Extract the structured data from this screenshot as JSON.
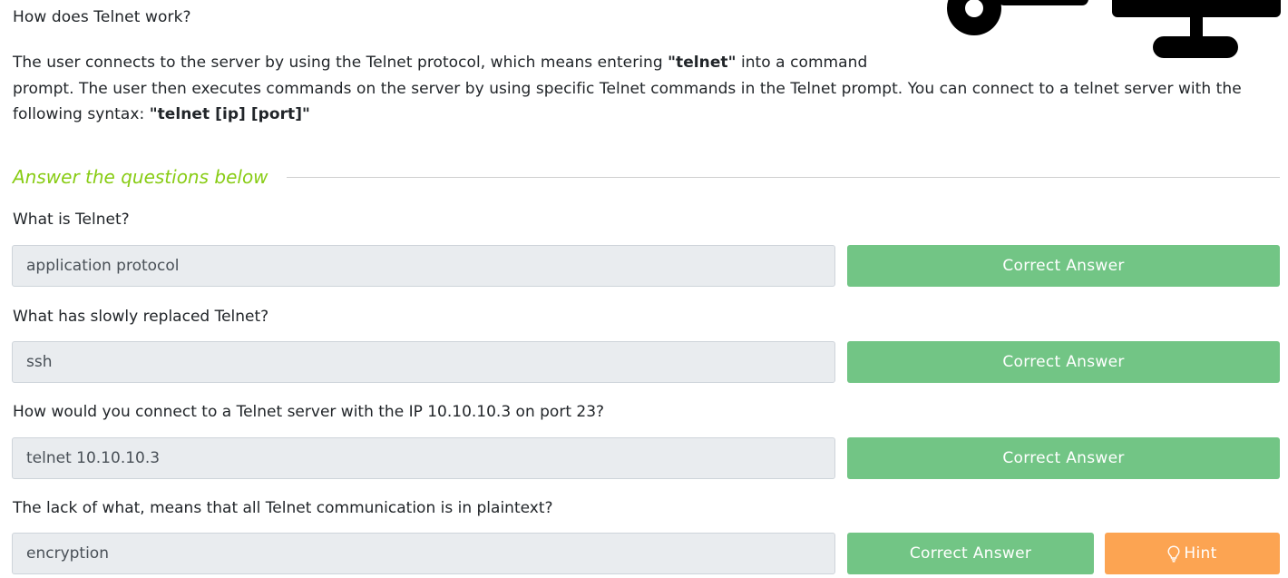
{
  "section": {
    "heading": "How does Telnet work?",
    "paragraph": {
      "line1_a": "The user connects to the server by using the Telnet protocol, which means entering ",
      "line1_b": "\"telnet\"",
      "line1_c": " into a command",
      "line2": "prompt. The user then executes commands on the server by using specific Telnet commands in the Telnet prompt. You can connect to a telnet server with the",
      "line3_a": "following syntax: ",
      "line3_b": "\"telnet [ip] [port]\""
    }
  },
  "answers": {
    "title": "Answer the questions below",
    "questions": [
      {
        "question": "What is Telnet?",
        "answer": "application protocol",
        "button": "Correct Answer"
      },
      {
        "question": "What has slowly replaced Telnet?",
        "answer": "ssh",
        "button": "Correct Answer"
      },
      {
        "question": "How would you connect to a Telnet server with the IP 10.10.10.3 on port 23?",
        "answer": "telnet 10.10.10.3",
        "button": "Correct Answer"
      },
      {
        "question": "The lack of what, means that all Telnet communication is in plaintext?",
        "answer": "encryption",
        "button": "Correct Answer",
        "hint": "Hint"
      }
    ]
  },
  "colors": {
    "accent": "#88cc14",
    "correct": "#72c585",
    "hint": "#fca452",
    "input_bg": "#e9ecef"
  },
  "icons": {
    "hint": "lightbulb-icon",
    "illustration": "network-illustration"
  }
}
